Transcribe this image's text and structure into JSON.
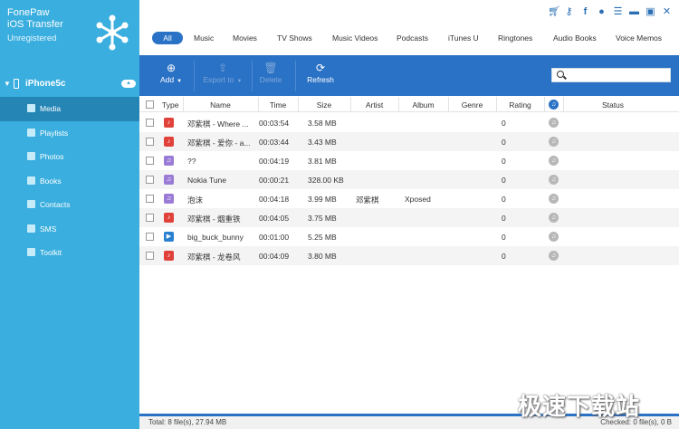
{
  "app": {
    "brand_line1": "FonePaw",
    "brand_line2": "iOS Transfer",
    "registration": "Unregistered"
  },
  "device": {
    "name": "iPhone5c"
  },
  "sidebar": {
    "items": [
      {
        "label": "Media",
        "active": true
      },
      {
        "label": "Playlists"
      },
      {
        "label": "Photos"
      },
      {
        "label": "Books"
      },
      {
        "label": "Contacts"
      },
      {
        "label": "SMS"
      },
      {
        "label": "Toolkit"
      }
    ]
  },
  "title_icons": [
    "cart-icon",
    "key-icon",
    "facebook-icon",
    "chat-icon",
    "menu-icon",
    "minimize-icon",
    "maximize-icon",
    "close-icon"
  ],
  "categories": [
    "All",
    "Music",
    "Movies",
    "TV Shows",
    "Music Videos",
    "Podcasts",
    "iTunes U",
    "Ringtones",
    "Audio Books",
    "Voice Memos"
  ],
  "toolbar": {
    "add": "Add",
    "export": "Export to",
    "delete": "Delete",
    "refresh": "Refresh",
    "search_placeholder": ""
  },
  "columns": {
    "type": "Type",
    "name": "Name",
    "time": "Time",
    "size": "Size",
    "artist": "Artist",
    "album": "Album",
    "genre": "Genre",
    "rating": "Rating",
    "status": "Status"
  },
  "rows": [
    {
      "type": "music",
      "name": "邓紫棋 - Where ...",
      "time": "00:03:54",
      "size": "3.58 MB",
      "artist": "",
      "album": "",
      "genre": "",
      "rating": "0"
    },
    {
      "type": "music",
      "name": "邓紫棋 - 爱你 - a...",
      "time": "00:03:44",
      "size": "3.43 MB",
      "artist": "",
      "album": "",
      "genre": "",
      "rating": "0"
    },
    {
      "type": "ringtone",
      "name": "??",
      "time": "00:04:19",
      "size": "3.81 MB",
      "artist": "",
      "album": "",
      "genre": "",
      "rating": "0"
    },
    {
      "type": "ringtone",
      "name": "Nokia Tune",
      "time": "00:00:21",
      "size": "328.00 KB",
      "artist": "",
      "album": "",
      "genre": "",
      "rating": "0"
    },
    {
      "type": "ringtone",
      "name": "泡沫",
      "time": "00:04:18",
      "size": "3.99 MB",
      "artist": "邓紫棋",
      "album": "Xposed",
      "genre": "",
      "rating": "0"
    },
    {
      "type": "music",
      "name": "邓紫棋 - 烟重铁",
      "time": "00:04:05",
      "size": "3.75 MB",
      "artist": "",
      "album": "",
      "genre": "",
      "rating": "0"
    },
    {
      "type": "video",
      "name": "big_buck_bunny",
      "time": "00:01:00",
      "size": "5.25 MB",
      "artist": "",
      "album": "",
      "genre": "",
      "rating": "0"
    },
    {
      "type": "music",
      "name": "邓紫棋 - 龙卷风",
      "time": "00:04:09",
      "size": "3.80 MB",
      "artist": "",
      "album": "",
      "genre": "",
      "rating": "0"
    }
  ],
  "status": {
    "total": "Total: 8 file(s), 27.94 MB",
    "checked": "Checked: 0 file(s), 0 B"
  },
  "watermark": "极速下载站"
}
